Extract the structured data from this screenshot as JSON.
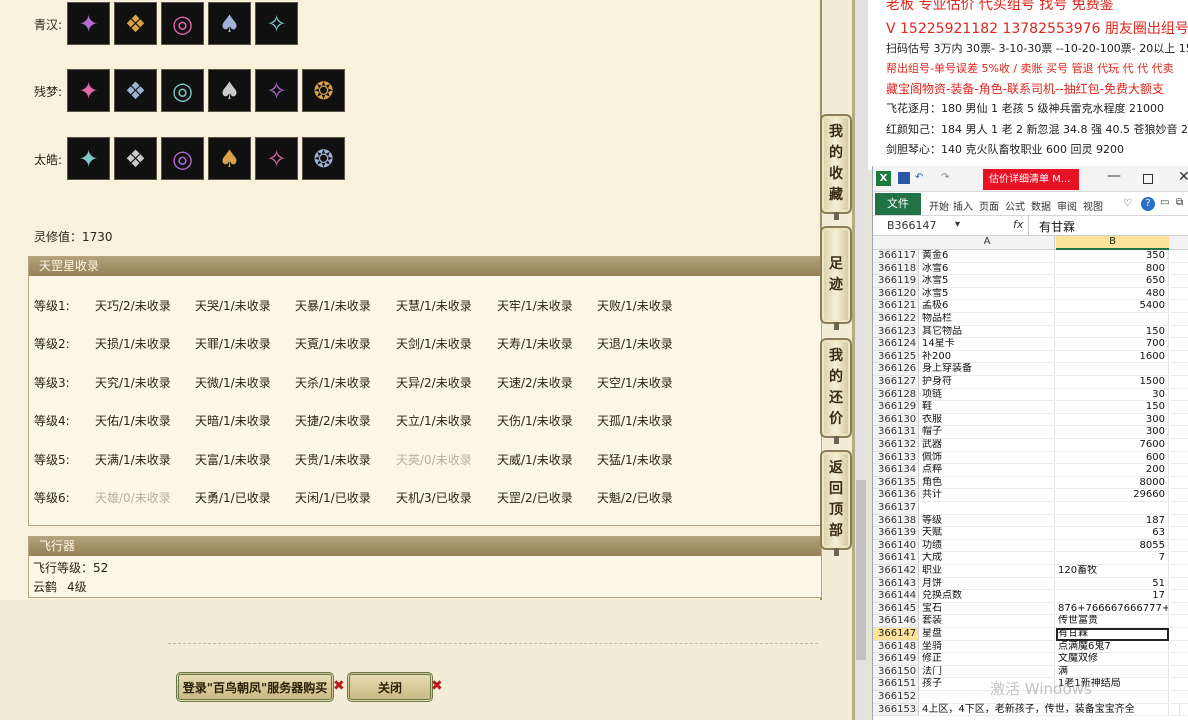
{
  "categories": [
    {
      "label": "青汉:",
      "icons": [
        "gem-crown-icon",
        "mask-icon",
        "ring-icon",
        "armor-icon",
        "staff-icon"
      ]
    },
    {
      "label": "残梦:",
      "icons": [
        "gem-crown-icon",
        "robe-icon",
        "butterfly-icon",
        "armor-icon",
        "flower-icon",
        "bracelet-icon"
      ]
    },
    {
      "label": "太皓:",
      "icons": [
        "spirit-icon",
        "wings-icon",
        "necklace-icon",
        "boots-icon",
        "sword-icon",
        "ring-icon"
      ]
    }
  ],
  "icon_glyphs": [
    "✦",
    "❖",
    "◎",
    "♠",
    "✧",
    "❂"
  ],
  "lingxiu": "灵修值：1730",
  "tiangang": {
    "title": "天罡星收录",
    "levels": [
      {
        "label": "等级1:",
        "stars": [
          {
            "t": "天巧/2/未收录",
            "dim": false
          },
          {
            "t": "天哭/1/未收录",
            "dim": false
          },
          {
            "t": "天暴/1/未收录",
            "dim": false
          },
          {
            "t": "天慧/1/未收录",
            "dim": false
          },
          {
            "t": "天牢/1/未收录",
            "dim": false
          },
          {
            "t": "天败/1/未收录",
            "dim": false
          }
        ]
      },
      {
        "label": "等级2:",
        "stars": [
          {
            "t": "天损/1/未收录",
            "dim": false
          },
          {
            "t": "天罪/1/未收录",
            "dim": false
          },
          {
            "t": "天覔/1/未收录",
            "dim": false
          },
          {
            "t": "天剑/1/未收录",
            "dim": false
          },
          {
            "t": "天寿/1/未收录",
            "dim": false
          },
          {
            "t": "天退/1/未收录",
            "dim": false
          }
        ]
      },
      {
        "label": "等级3:",
        "stars": [
          {
            "t": "天究/1/未收录",
            "dim": false
          },
          {
            "t": "天微/1/未收录",
            "dim": false
          },
          {
            "t": "天杀/1/未收录",
            "dim": false
          },
          {
            "t": "天异/2/未收录",
            "dim": false
          },
          {
            "t": "天速/2/未收录",
            "dim": false
          },
          {
            "t": "天空/1/未收录",
            "dim": false
          }
        ]
      },
      {
        "label": "等级4:",
        "stars": [
          {
            "t": "天佑/1/未收录",
            "dim": false
          },
          {
            "t": "天暗/1/未收录",
            "dim": false
          },
          {
            "t": "天捷/2/未收录",
            "dim": false
          },
          {
            "t": "天立/1/未收录",
            "dim": false
          },
          {
            "t": "天伤/1/未收录",
            "dim": false
          },
          {
            "t": "天孤/1/未收录",
            "dim": false
          }
        ]
      },
      {
        "label": "等级5:",
        "stars": [
          {
            "t": "天满/1/未收录",
            "dim": false
          },
          {
            "t": "天富/1/未收录",
            "dim": false
          },
          {
            "t": "天贵/1/未收录",
            "dim": false
          },
          {
            "t": "天英/0/未收录",
            "dim": true
          },
          {
            "t": "天威/1/未收录",
            "dim": false
          },
          {
            "t": "天猛/1/未收录",
            "dim": false
          }
        ]
      },
      {
        "label": "等级6:",
        "stars": [
          {
            "t": "天雄/0/未收录",
            "dim": true
          },
          {
            "t": "天勇/1/已收录",
            "dim": false
          },
          {
            "t": "天闲/1/已收录",
            "dim": false
          },
          {
            "t": "天机/3/已收录",
            "dim": false
          },
          {
            "t": "天罡/2/已收录",
            "dim": false
          },
          {
            "t": "天魁/2/已收录",
            "dim": false
          }
        ]
      }
    ]
  },
  "flyer": {
    "title": "飞行器",
    "level": "飞行等级：52",
    "name": "云鹤",
    "grade": "4级"
  },
  "side_tabs": [
    {
      "chars": [
        "我",
        "的",
        "收",
        "藏"
      ]
    },
    {
      "chars": [
        "足",
        "迹"
      ]
    },
    {
      "chars": [
        "我",
        "的",
        "还",
        "价"
      ]
    },
    {
      "chars": [
        "返",
        "回",
        "顶",
        "部"
      ]
    }
  ],
  "buttons": {
    "login": "登录\"百鸟朝凤\"服务器购买",
    "close": "关闭",
    "x": "✖"
  },
  "doc": {
    "line0": "老板 专业估价 代买组号 找号 免费鉴",
    "line1": "V 15225921182   13782553976 朋友圈出组号",
    "line2": "扫码估号 3万内 30票- 3-10-30票  --10-20-100票- 20以上 15",
    "line3": "帮出组号-单号误差 5%收 / 卖账 买号 管退 代玩 代 代 代卖",
    "line4": "藏宝阁物资-装备-角色-联系司机--抽红包-免费大额支",
    "line5": "飞花逐月：180 男仙 1 老孩 5 级神兵雷克水程度 21000",
    "line6": "红颜知己：184 男人 1 老 2 新忽混 34.8 强 40.5 苍狼妙音 229",
    "line7": "剑胆琴心：140 克火队畜牧职业 600 回灵 9200"
  },
  "excel": {
    "file_tab": "估价详细清单 M...",
    "ribbon": [
      "文件",
      "开始",
      "插入",
      "页面",
      "公式",
      "数据",
      "审阅",
      "视图"
    ],
    "name_box": "B366147",
    "fx": "fx",
    "formula": "有甘霖",
    "col_a": "A",
    "col_b": "B",
    "rows": [
      {
        "n": "366117",
        "a": "黄金6",
        "b": "350",
        "num": true
      },
      {
        "n": "366118",
        "a": "冰雪6",
        "b": "800",
        "num": true
      },
      {
        "n": "366119",
        "a": "冰雪5",
        "b": "650",
        "num": true
      },
      {
        "n": "366120",
        "a": "冰雪5",
        "b": "480",
        "num": true
      },
      {
        "n": "366121",
        "a": "孟极6",
        "b": "5400",
        "num": true
      },
      {
        "n": "366122",
        "a": "物品栏",
        "b": "",
        "num": true
      },
      {
        "n": "366123",
        "a": "其它物品",
        "b": "150",
        "num": true
      },
      {
        "n": "366124",
        "a": "14星卡",
        "b": "700",
        "num": true
      },
      {
        "n": "366125",
        "a": "补200",
        "b": "1600",
        "num": true
      },
      {
        "n": "366126",
        "a": "身上穿装备",
        "b": "",
        "num": true
      },
      {
        "n": "366127",
        "a": "护身符",
        "b": "1500",
        "num": true
      },
      {
        "n": "366128",
        "a": "项链",
        "b": "30",
        "num": true
      },
      {
        "n": "366129",
        "a": "鞋",
        "b": "150",
        "num": true
      },
      {
        "n": "366130",
        "a": "衣服",
        "b": "300",
        "num": true
      },
      {
        "n": "366131",
        "a": "帽子",
        "b": "300",
        "num": true
      },
      {
        "n": "366132",
        "a": "武器",
        "b": "7600",
        "num": true
      },
      {
        "n": "366133",
        "a": "佩饰",
        "b": "600",
        "num": true
      },
      {
        "n": "366134",
        "a": "点粹",
        "b": "200",
        "num": true
      },
      {
        "n": "366135",
        "a": "角色",
        "b": "8000",
        "num": true
      },
      {
        "n": "366136",
        "a": "共计",
        "b": "29660",
        "num": true
      },
      {
        "n": "366137",
        "a": "",
        "b": "",
        "num": true
      },
      {
        "n": "366138",
        "a": "等级",
        "b": "187",
        "num": true
      },
      {
        "n": "366139",
        "a": "天赋",
        "b": "63",
        "num": true
      },
      {
        "n": "366140",
        "a": "功绩",
        "b": "8055",
        "num": true
      },
      {
        "n": "366141",
        "a": "大成",
        "b": "7",
        "num": true
      },
      {
        "n": "366142",
        "a": "职业",
        "b": "120畜牧",
        "num": false
      },
      {
        "n": "366143",
        "a": "月饼",
        "b": "51",
        "num": true
      },
      {
        "n": "366144",
        "a": "兑换点数",
        "b": "17",
        "num": true
      },
      {
        "n": "366145",
        "a": "宝石",
        "b": "876+766667666777+",
        "num": false
      },
      {
        "n": "366146",
        "a": "套装",
        "b": "传世富贵",
        "num": false
      },
      {
        "n": "366147",
        "a": "星盘",
        "b": "有甘霖",
        "num": false,
        "active": true
      },
      {
        "n": "366148",
        "a": "坐骑",
        "b": "点满魔6鬼7",
        "num": false
      },
      {
        "n": "366149",
        "a": "修正",
        "b": "文魔双修",
        "num": false
      },
      {
        "n": "366150",
        "a": "法门",
        "b": "满",
        "num": false
      },
      {
        "n": "366151",
        "a": "孩子",
        "b": "1老1新神结局",
        "num": false
      },
      {
        "n": "366152",
        "a": "",
        "b": "",
        "num": false
      },
      {
        "n": "366153",
        "a": "4上区，4下区，老新孩子，传世，装备宝宝齐全",
        "b": "",
        "num": false
      }
    ]
  },
  "watermark": "激活 Windows"
}
